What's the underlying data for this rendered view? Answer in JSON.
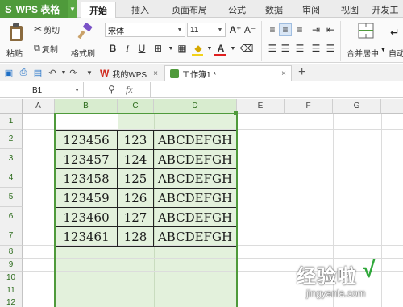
{
  "app": {
    "title": "WPS 表格",
    "logo": "S"
  },
  "menu": {
    "tabs": [
      "开始",
      "插入",
      "页面布局",
      "公式",
      "数据",
      "审阅",
      "视图",
      "开发工"
    ],
    "active": "开始"
  },
  "ribbon": {
    "paste": "粘贴",
    "cut": "剪切",
    "copy": "复制",
    "format_painter": "格式刷",
    "font_name": "宋体",
    "font_size": "11",
    "bold": "B",
    "italic": "I",
    "underline": "U",
    "merge_center": "合并居中",
    "auto_wrap": "自动"
  },
  "tabs": {
    "wps_home": "我的WPS",
    "workbook": "工作簿1 *",
    "add": "+"
  },
  "formula_bar": {
    "name_box": "B1",
    "fx": "fx",
    "value": ""
  },
  "columns": [
    "A",
    "B",
    "C",
    "D",
    "E",
    "F",
    "G"
  ],
  "rows": [
    "1",
    "2",
    "3",
    "4",
    "5",
    "6",
    "7",
    "8",
    "9",
    "10",
    "11",
    "12"
  ],
  "cells": [
    [
      "123456",
      "123",
      "ABCDEFGH"
    ],
    [
      "123457",
      "124",
      "ABCDEFGH"
    ],
    [
      "123458",
      "125",
      "ABCDEFGH"
    ],
    [
      "123459",
      "126",
      "ABCDEFGH"
    ],
    [
      "123460",
      "127",
      "ABCDEFGH"
    ],
    [
      "123461",
      "128",
      "ABCDEFGH"
    ]
  ],
  "watermark": {
    "main": "经验啦",
    "check": "√",
    "url": "jingyanla.com"
  },
  "colors": {
    "brand": "#4f9a3b",
    "selection": "#e3f1dc",
    "selection_border": "#4f9a3b"
  }
}
